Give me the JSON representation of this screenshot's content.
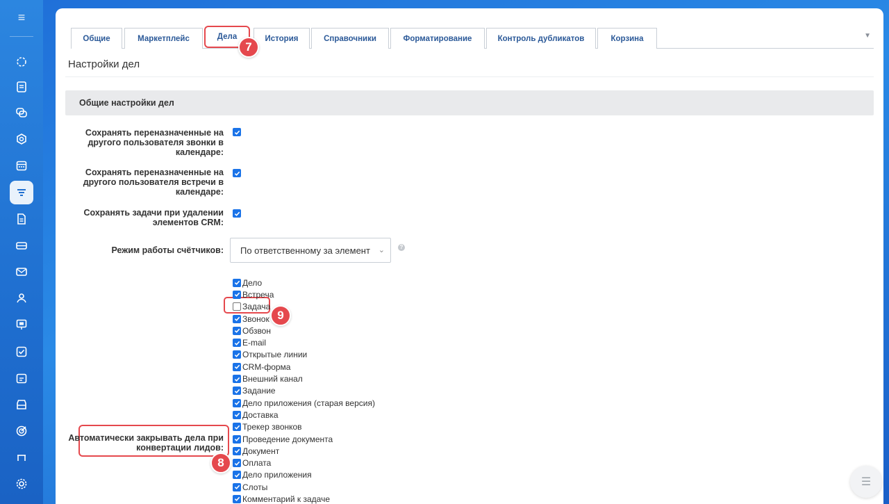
{
  "tabs": [
    {
      "label": "Общие"
    },
    {
      "label": "Маркетплейс"
    },
    {
      "label": "Дела"
    },
    {
      "label": "История"
    },
    {
      "label": "Справочники"
    },
    {
      "label": "Форматирование"
    },
    {
      "label": "Контроль дубликатов"
    },
    {
      "label": "Корзина"
    }
  ],
  "active_tab": "Дела",
  "page_title": "Настройки дел",
  "section_title": "Общие настройки дел",
  "settings": [
    {
      "label": "Сохранять переназначенные на другого пользователя звонки в календаре:",
      "checked": true
    },
    {
      "label": "Сохранять переназначенные на другого пользователя встречи в календаре:",
      "checked": true
    },
    {
      "label": "Сохранять задачи при удалении элементов CRM:",
      "checked": true
    }
  ],
  "counter_mode": {
    "label": "Режим работы счётчиков:",
    "value": "По ответственному за элемент",
    "help": "?"
  },
  "auto_close": {
    "label": "Автоматически закрывать дела при конвертации лидов:",
    "items": [
      {
        "label": "Дело",
        "checked": true
      },
      {
        "label": "Встреча",
        "checked": true
      },
      {
        "label": "Задача",
        "checked": false
      },
      {
        "label": "Звонок",
        "checked": true
      },
      {
        "label": "Обзвон",
        "checked": true
      },
      {
        "label": "E-mail",
        "checked": true
      },
      {
        "label": "Открытые линии",
        "checked": true
      },
      {
        "label": "CRM-форма",
        "checked": true
      },
      {
        "label": "Внешний канал",
        "checked": true
      },
      {
        "label": "Задание",
        "checked": true
      },
      {
        "label": "Дело приложения (старая версия)",
        "checked": true
      },
      {
        "label": "Доставка",
        "checked": true
      },
      {
        "label": "Трекер звонков",
        "checked": true
      },
      {
        "label": "Проведение документа",
        "checked": true
      },
      {
        "label": "Документ",
        "checked": true
      },
      {
        "label": "Оплата",
        "checked": true
      },
      {
        "label": "Дело приложения",
        "checked": true
      },
      {
        "label": "Слоты",
        "checked": true
      },
      {
        "label": "Комментарий к задаче",
        "checked": true
      }
    ]
  },
  "annotations": {
    "tab_badge": "7",
    "label_badge": "8",
    "item_badge": "9"
  },
  "colors": {
    "accent": "#1a73e8",
    "highlight": "#e5484d",
    "tab_text": "#2b5998"
  },
  "sidebar_icons": [
    "menu-icon",
    "flow-icon",
    "feed-icon",
    "chat-icon",
    "hexagon-icon",
    "calendar-icon",
    "crm-funnel-icon",
    "document-icon",
    "inbox-icon",
    "mail-icon",
    "contacts-icon",
    "presentation-icon",
    "tasks-icon",
    "schedule-icon",
    "store-icon",
    "target-icon",
    "cart-icon",
    "settings-icon"
  ]
}
